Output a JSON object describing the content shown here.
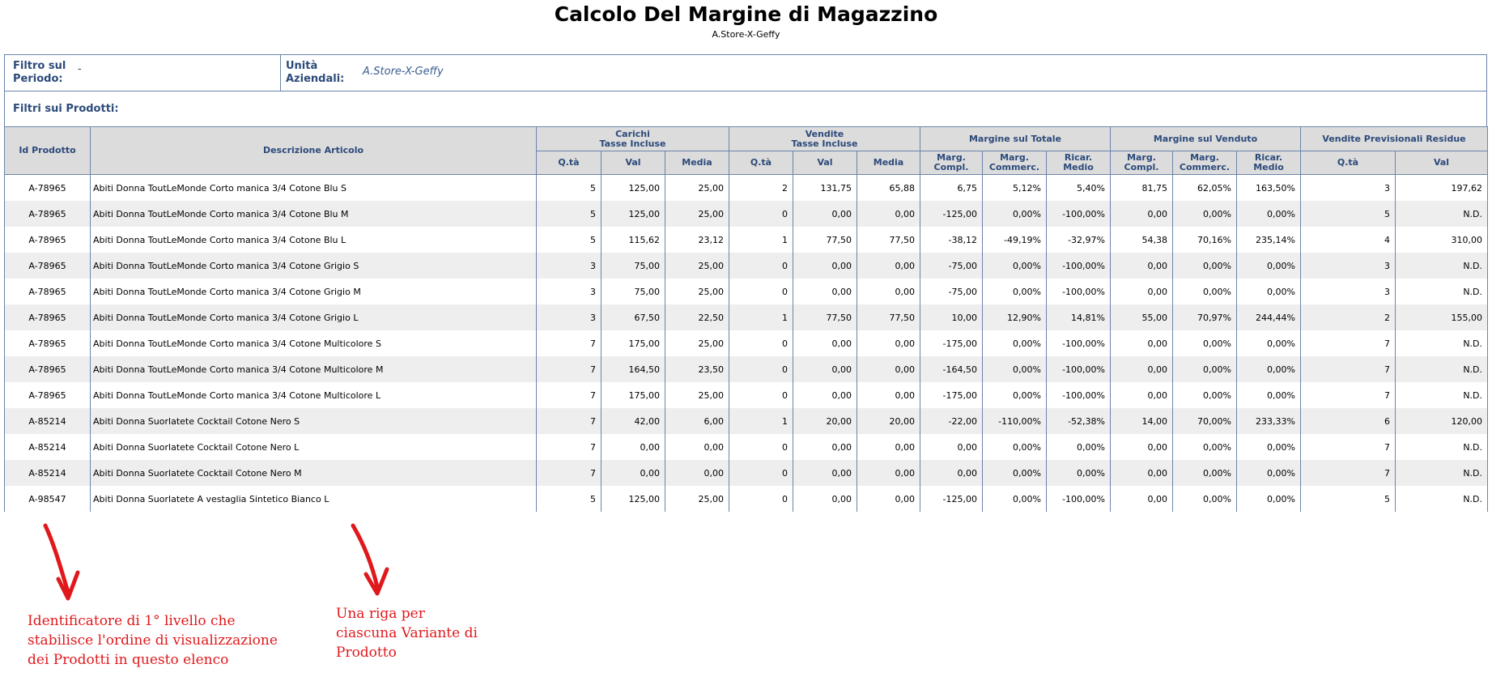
{
  "header": {
    "title": "Calcolo Del Margine di Magazzino",
    "subtitle": "A.Store-X-Geffy"
  },
  "filters": {
    "period_label": "Filtro sul Periodo:",
    "period_value": "-",
    "units_label": "Unità Aziendali:",
    "units_value": "A.Store-X-Geffy",
    "products_label": "Filtri sui Prodotti:"
  },
  "table": {
    "groups": {
      "carichi": "Carichi Tasse Incluse",
      "vendite": "Vendite Tasse Incluse",
      "margine_totale": "Margine sul Totale",
      "margine_venduto": "Margine sul Venduto",
      "previsionali": "Vendite Previsionali Residue"
    },
    "columns": {
      "id": "Id Prodotto",
      "desc": "Descrizione Articolo",
      "qta": "Q.tà",
      "val": "Val",
      "media": "Media",
      "marg_compl": "Marg. Compl.",
      "marg_commerc": "Marg. Commerc.",
      "ricar_medio": "Ricar. Medio"
    },
    "rows": [
      [
        "A-78965",
        "Abiti Donna ToutLeMonde Corto manica 3/4 Cotone Blu S",
        "5",
        "125,00",
        "25,00",
        "2",
        "131,75",
        "65,88",
        "6,75",
        "5,12%",
        "5,40%",
        "81,75",
        "62,05%",
        "163,50%",
        "3",
        "197,62"
      ],
      [
        "A-78965",
        "Abiti Donna ToutLeMonde Corto manica 3/4 Cotone Blu M",
        "5",
        "125,00",
        "25,00",
        "0",
        "0,00",
        "0,00",
        "-125,00",
        "0,00%",
        "-100,00%",
        "0,00",
        "0,00%",
        "0,00%",
        "5",
        "N.D."
      ],
      [
        "A-78965",
        "Abiti Donna ToutLeMonde Corto manica 3/4 Cotone Blu L",
        "5",
        "115,62",
        "23,12",
        "1",
        "77,50",
        "77,50",
        "-38,12",
        "-49,19%",
        "-32,97%",
        "54,38",
        "70,16%",
        "235,14%",
        "4",
        "310,00"
      ],
      [
        "A-78965",
        "Abiti Donna ToutLeMonde Corto manica 3/4 Cotone Grigio S",
        "3",
        "75,00",
        "25,00",
        "0",
        "0,00",
        "0,00",
        "-75,00",
        "0,00%",
        "-100,00%",
        "0,00",
        "0,00%",
        "0,00%",
        "3",
        "N.D."
      ],
      [
        "A-78965",
        "Abiti Donna ToutLeMonde Corto manica 3/4 Cotone Grigio M",
        "3",
        "75,00",
        "25,00",
        "0",
        "0,00",
        "0,00",
        "-75,00",
        "0,00%",
        "-100,00%",
        "0,00",
        "0,00%",
        "0,00%",
        "3",
        "N.D."
      ],
      [
        "A-78965",
        "Abiti Donna ToutLeMonde Corto manica 3/4 Cotone Grigio L",
        "3",
        "67,50",
        "22,50",
        "1",
        "77,50",
        "77,50",
        "10,00",
        "12,90%",
        "14,81%",
        "55,00",
        "70,97%",
        "244,44%",
        "2",
        "155,00"
      ],
      [
        "A-78965",
        "Abiti Donna ToutLeMonde Corto manica 3/4 Cotone Multicolore S",
        "7",
        "175,00",
        "25,00",
        "0",
        "0,00",
        "0,00",
        "-175,00",
        "0,00%",
        "-100,00%",
        "0,00",
        "0,00%",
        "0,00%",
        "7",
        "N.D."
      ],
      [
        "A-78965",
        "Abiti Donna ToutLeMonde Corto manica 3/4 Cotone Multicolore M",
        "7",
        "164,50",
        "23,50",
        "0",
        "0,00",
        "0,00",
        "-164,50",
        "0,00%",
        "-100,00%",
        "0,00",
        "0,00%",
        "0,00%",
        "7",
        "N.D."
      ],
      [
        "A-78965",
        "Abiti Donna ToutLeMonde Corto manica 3/4 Cotone Multicolore L",
        "7",
        "175,00",
        "25,00",
        "0",
        "0,00",
        "0,00",
        "-175,00",
        "0,00%",
        "-100,00%",
        "0,00",
        "0,00%",
        "0,00%",
        "7",
        "N.D."
      ],
      [
        "A-85214",
        "Abiti Donna Suorlatete Cocktail Cotone Nero S",
        "7",
        "42,00",
        "6,00",
        "1",
        "20,00",
        "20,00",
        "-22,00",
        "-110,00%",
        "-52,38%",
        "14,00",
        "70,00%",
        "233,33%",
        "6",
        "120,00"
      ],
      [
        "A-85214",
        "Abiti Donna Suorlatete Cocktail Cotone Nero L",
        "7",
        "0,00",
        "0,00",
        "0",
        "0,00",
        "0,00",
        "0,00",
        "0,00%",
        "0,00%",
        "0,00",
        "0,00%",
        "0,00%",
        "7",
        "N.D."
      ],
      [
        "A-85214",
        "Abiti Donna Suorlatete Cocktail Cotone Nero M",
        "7",
        "0,00",
        "0,00",
        "0",
        "0,00",
        "0,00",
        "0,00",
        "0,00%",
        "0,00%",
        "0,00",
        "0,00%",
        "0,00%",
        "7",
        "N.D."
      ],
      [
        "A-98547",
        "Abiti Donna Suorlatete A vestaglia Sintetico Bianco L",
        "5",
        "125,00",
        "25,00",
        "0",
        "0,00",
        "0,00",
        "-125,00",
        "0,00%",
        "-100,00%",
        "0,00",
        "0,00%",
        "0,00%",
        "5",
        "N.D."
      ]
    ]
  },
  "annotations": {
    "left": "Identificatore di 1° livello che stabilisce l'ordine di visualizzazione dei Prodotti in questo elenco",
    "right": "Una riga per ciascuna Variante di Prodotto",
    "color": "#e0181c"
  }
}
